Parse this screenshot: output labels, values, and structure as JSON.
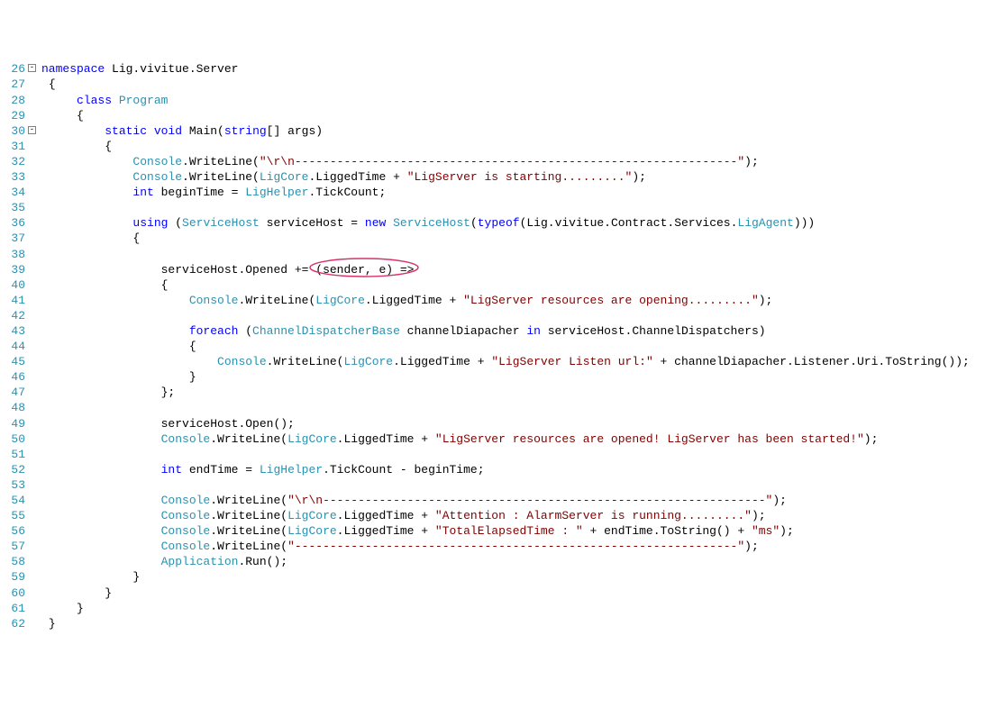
{
  "lineStart": 26,
  "lineEnd": 62,
  "foldMarkers": [
    {
      "line": 26,
      "symbol": "-"
    },
    {
      "line": 30,
      "symbol": "-"
    }
  ],
  "code": {
    "l26": {
      "kw1": "namespace",
      "txt1": " Lig.vivitue.Server"
    },
    "l27": {
      "txt1": "{"
    },
    "l28": {
      "kw1": "class",
      "type1": " Program"
    },
    "l29": {
      "txt1": "{"
    },
    "l30": {
      "kw1": "static",
      "kw2": " void",
      "txt1": " Main(",
      "kw3": "string",
      "txt2": "[] args)"
    },
    "l31": {
      "txt1": "{"
    },
    "l32": {
      "type1": "Console",
      "txt1": ".WriteLine(",
      "str1": "\"\\r\\n---------------------------------------------------------------\"",
      "txt2": ");"
    },
    "l33": {
      "type1": "Console",
      "txt1": ".WriteLine(",
      "type2": "LigCore",
      "txt2": ".LiggedTime + ",
      "str1": "\"LigServer is starting.........\"",
      "txt3": ");"
    },
    "l34": {
      "kw1": "int",
      "txt1": " beginTime = ",
      "type1": "LigHelper",
      "txt2": ".TickCount;"
    },
    "l36": {
      "kw1": "using",
      "txt1": " (",
      "type1": "ServiceHost",
      "txt2": " serviceHost = ",
      "kw2": "new",
      "type2": " ServiceHost",
      "txt3": "(",
      "kw3": "typeof",
      "txt4": "(Lig.vivitue.Contract.Services.",
      "type3": "LigAgent",
      "txt5": ")))"
    },
    "l37": {
      "txt1": "{"
    },
    "l39": {
      "txt1": "serviceHost.Opened += ",
      "circled": "(sender, e) =>"
    },
    "l40": {
      "txt1": "{"
    },
    "l41": {
      "type1": "Console",
      "txt1": ".WriteLine(",
      "type2": "LigCore",
      "txt2": ".LiggedTime + ",
      "str1": "\"LigServer resources are opening.........\"",
      "txt3": ");"
    },
    "l43": {
      "kw1": "foreach",
      "txt1": " (",
      "type1": "ChannelDispatcherBase",
      "txt2": " channelDiapacher ",
      "kw2": "in",
      "txt3": " serviceHost.ChannelDispatchers)"
    },
    "l44": {
      "txt1": "{"
    },
    "l45": {
      "type1": "Console",
      "txt1": ".WriteLine(",
      "type2": "LigCore",
      "txt2": ".LiggedTime + ",
      "str1": "\"LigServer Listen url:\"",
      "txt3": " + channelDiapacher.Listener.Uri.ToString());"
    },
    "l46": {
      "txt1": "}"
    },
    "l47": {
      "txt1": "};"
    },
    "l49": {
      "txt1": "serviceHost.Open();"
    },
    "l50": {
      "type1": "Console",
      "txt1": ".WriteLine(",
      "type2": "LigCore",
      "txt2": ".LiggedTime + ",
      "str1": "\"LigServer resources are opened! LigServer has been started!\"",
      "txt3": ");"
    },
    "l52": {
      "kw1": "int",
      "txt1": " endTime = ",
      "type1": "LigHelper",
      "txt2": ".TickCount - beginTime;"
    },
    "l54": {
      "type1": "Console",
      "txt1": ".WriteLine(",
      "str1": "\"\\r\\n---------------------------------------------------------------\"",
      "txt2": ");"
    },
    "l55": {
      "type1": "Console",
      "txt1": ".WriteLine(",
      "type2": "LigCore",
      "txt2": ".LiggedTime + ",
      "str1": "\"Attention : AlarmServer is running.........\"",
      "txt3": ");"
    },
    "l56": {
      "type1": "Console",
      "txt1": ".WriteLine(",
      "type2": "LigCore",
      "txt2": ".LiggedTime + ",
      "str1": "\"TotalElapsedTime : \"",
      "txt3": " + endTime.ToString() + ",
      "str2": "\"ms\"",
      "txt4": ");"
    },
    "l57": {
      "type1": "Console",
      "txt1": ".WriteLine(",
      "str1": "\"---------------------------------------------------------------\"",
      "txt2": ");"
    },
    "l58": {
      "type1": "Application",
      "txt1": ".Run();"
    },
    "l59": {
      "txt1": "}"
    },
    "l60": {
      "txt1": "}"
    },
    "l61": {
      "txt1": "}"
    },
    "l62": {
      "txt1": "}"
    }
  },
  "indents": {
    "l26": 0,
    "l27": 1,
    "l28": 5,
    "l29": 5,
    "l30": 9,
    "l31": 9,
    "l32": 13,
    "l33": 13,
    "l34": 13,
    "l36": 13,
    "l37": 13,
    "l39": 17,
    "l40": 17,
    "l41": 21,
    "l43": 21,
    "l44": 21,
    "l45": 25,
    "l46": 21,
    "l47": 17,
    "l49": 17,
    "l50": 17,
    "l52": 17,
    "l54": 17,
    "l55": 17,
    "l56": 17,
    "l57": 17,
    "l58": 17,
    "l59": 13,
    "l60": 9,
    "l61": 5,
    "l62": 1
  }
}
